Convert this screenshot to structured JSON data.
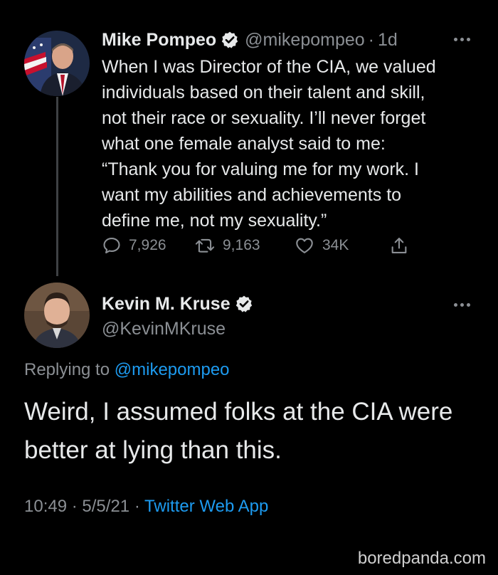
{
  "tweet1": {
    "author_name": "Mike Pompeo",
    "handle": "@mikepompeo",
    "separator": "·",
    "age": "1d",
    "body_lines": [
      "When I was Director of the CIA, we valued",
      "individuals based on their talent and skill,",
      "not their race or sexuality. I’ll never forget",
      "what one female analyst said to me:",
      "“Thank you for valuing me for my work. I",
      "want my abilities and achievements to",
      "define me, not my sexuality.”"
    ],
    "counts": {
      "replies": "7,926",
      "retweets": "9,163",
      "likes": "34K"
    }
  },
  "tweet2": {
    "author_name": "Kevin M. Kruse",
    "handle": "@KevinMKruse",
    "replying_prefix": "Replying to",
    "replying_to": "@mikepompeo",
    "body_lines": [
      "Weird, I assumed folks at the CIA were",
      "better at lying than this."
    ],
    "time": "10:49",
    "date": "5/5/21",
    "separator": "·",
    "source": "Twitter Web App"
  },
  "icons": {
    "verified": "verified-badge-icon",
    "reply": "reply-icon",
    "retweet": "retweet-icon",
    "like": "heart-icon",
    "share": "share-icon",
    "more": "more-options-icon"
  },
  "watermark": "boredpanda.com",
  "colors": {
    "background": "#000000",
    "text": "#e7e9ea",
    "muted": "#8b8f94",
    "link": "#1d9bf0",
    "thread_line": "#3e4144"
  }
}
